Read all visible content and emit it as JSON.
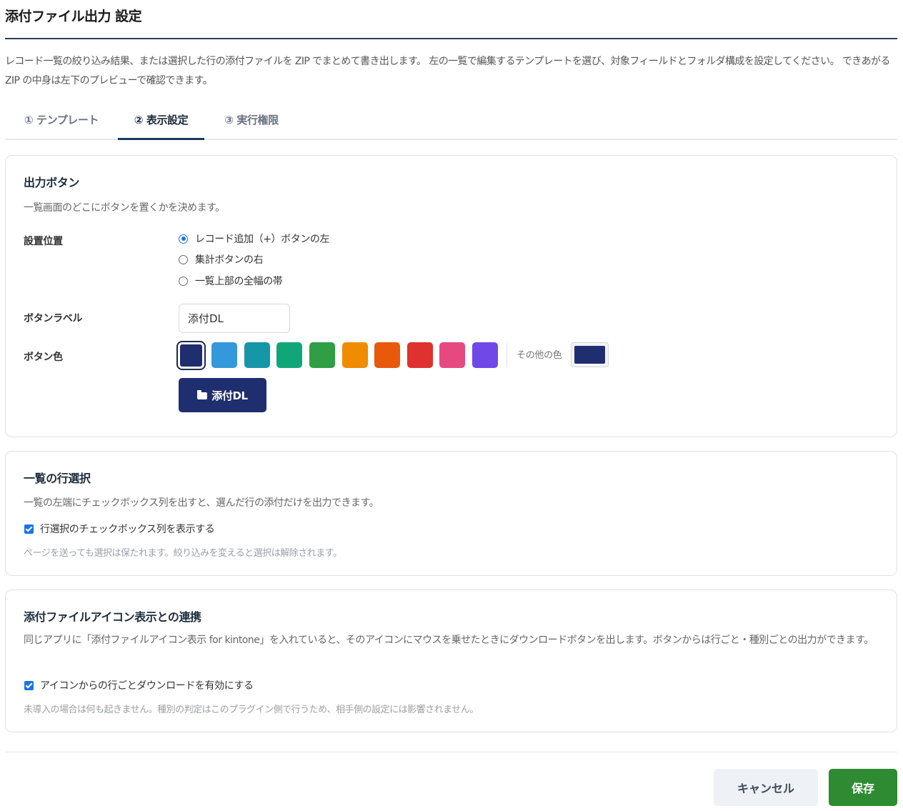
{
  "header": {
    "title": "添付ファイル出力 設定",
    "description": "レコード一覧の絞り込み結果、または選択した行の添付ファイルを ZIP でまとめて書き出します。 左の一覧で編集するテンプレートを選び、対象フィールドとフォルダ構成を設定してください。 できあがる ZIP の中身は左下のプレビューで確認できます。"
  },
  "tabs": [
    {
      "label": "① テンプレート",
      "active": false
    },
    {
      "label": "② 表示設定",
      "active": true
    },
    {
      "label": "③ 実行権限",
      "active": false
    }
  ],
  "output_button": {
    "title": "出力ボタン",
    "description": "一覧画面のどこにボタンを置くかを決めます。",
    "position_label": "設置位置",
    "position_options": [
      {
        "label": "レコード追加（+）ボタンの左",
        "checked": true
      },
      {
        "label": "集計ボタンの右",
        "checked": false
      },
      {
        "label": "一覧上部の全幅の帯",
        "checked": false
      }
    ],
    "label_field_label": "ボタンラベル",
    "label_value": "添付DL",
    "color_label": "ボタン色",
    "colors": [
      "#1e2e6e",
      "#3498db",
      "#1597a8",
      "#11a67a",
      "#2f9e44",
      "#f08c00",
      "#e8590c",
      "#e03131",
      "#e64980",
      "#7048e8"
    ],
    "selected_color": "#1e2e6e",
    "other_color_label": "その他の色",
    "custom_color": "#1e2e6e",
    "preview_label": "添付DL"
  },
  "row_select": {
    "title": "一覧の行選択",
    "description": "一覧の左端にチェックボックス列を出すと、選んだ行の添付だけを出力できます。",
    "checkbox_label": "行選択のチェックボックス列を表示する",
    "checked": true,
    "hint": "ページを送っても選択は保たれます。絞り込みを変えると選択は解除されます。"
  },
  "icon_link": {
    "title": "添付ファイルアイコン表示との連携",
    "description": "同じアプリに「添付ファイルアイコン表示 for kintone」を入れていると、そのアイコンにマウスを乗せたときにダウンロードボタンを出します。ボタンからは行ごと・種別ごとの出力ができます。",
    "checkbox_label": "アイコンからの行ごとダウンロードを有効にする",
    "checked": true,
    "hint": "未導入の場合は何も起きません。種別の判定はこのプラグイン側で行うため、相手側の設定には影響されません。"
  },
  "footer": {
    "cancel_label": "キャンセル",
    "save_label": "保存"
  }
}
